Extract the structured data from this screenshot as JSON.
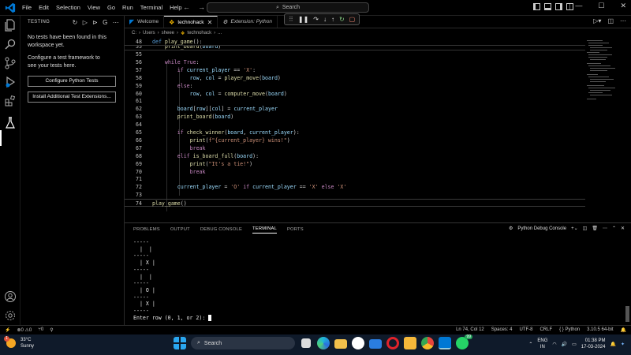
{
  "colors": {
    "keyword": "#c586c0",
    "def_keyword": "#569cd6",
    "function": "#dcdcaa",
    "string": "#ce9178",
    "variable": "#9cdcfe",
    "vscode_blue": "#0078d4",
    "python_tab_icon": "#f0b400"
  },
  "titlebar": {
    "menu": [
      "File",
      "Edit",
      "Selection",
      "View",
      "Go",
      "Run",
      "Terminal",
      "Help"
    ],
    "search_label": "Search",
    "icon": "vscode-logo-icon"
  },
  "sidebar": {
    "title": "TESTING",
    "empty_message": "No tests have been found in this workspace yet.",
    "configure_message": "Configure a test framework to see your tests here.",
    "configure_button": "Configure Python Tests",
    "install_button": "Install Additional Test Extensions..."
  },
  "tabs": [
    {
      "label": "Welcome",
      "active": false,
      "preview": false
    },
    {
      "label": "technohack",
      "active": true,
      "preview": false
    },
    {
      "label": "Extension: Python",
      "active": false,
      "preview": true
    }
  ],
  "breadcrumb": [
    "C:",
    "Users",
    "sheee",
    "technohack",
    "..."
  ],
  "editor": {
    "sticky": [
      {
        "n": "48",
        "text": "def play_game():"
      },
      {
        "n": "55",
        "text": "    print_board(board)"
      }
    ],
    "lines": [
      {
        "n": "55",
        "text": ""
      },
      {
        "n": "56",
        "text": "    while True:"
      },
      {
        "n": "57",
        "text": "        if current_player == 'X':"
      },
      {
        "n": "58",
        "text": "            row, col = player_move(board)"
      },
      {
        "n": "59",
        "text": "        else:"
      },
      {
        "n": "60",
        "text": "            row, col = computer_move(board)"
      },
      {
        "n": "61",
        "text": ""
      },
      {
        "n": "62",
        "text": "        board[row][col] = current_player"
      },
      {
        "n": "63",
        "text": "        print_board(board)"
      },
      {
        "n": "64",
        "text": ""
      },
      {
        "n": "65",
        "text": "        if check_winner(board, current_player):"
      },
      {
        "n": "66",
        "text": "            print(f\"{current_player} wins!\")"
      },
      {
        "n": "67",
        "text": "            break"
      },
      {
        "n": "68",
        "text": "        elif is_board_full(board):"
      },
      {
        "n": "69",
        "text": "            print(\"It's a tie!\")"
      },
      {
        "n": "70",
        "text": "            break"
      },
      {
        "n": "71",
        "text": ""
      },
      {
        "n": "72",
        "text": "        current_player = 'O' if current_player == 'X' else 'X'"
      },
      {
        "n": "73",
        "text": ""
      },
      {
        "n": "74",
        "text": "play_game()"
      }
    ],
    "current_line": "74"
  },
  "panel": {
    "tabs": [
      "PROBLEMS",
      "OUTPUT",
      "DEBUG CONSOLE",
      "TERMINAL",
      "PORTS"
    ],
    "active_tab": "TERMINAL",
    "terminal_name": "Python Debug Console",
    "terminal_lines": [
      "-----",
      "  |  |",
      "-----",
      "  | X |",
      "-----",
      "  |  |",
      "-----",
      "  | O |",
      "-----",
      "  | X |",
      "-----"
    ],
    "prompt": "Enter row (0, 1, or 2): "
  },
  "statusbar": {
    "errors": "0",
    "warnings": "0",
    "ports": "0",
    "position": "Ln 74, Col 12",
    "spaces": "Spaces: 4",
    "encoding": "UTF-8",
    "eol": "CRLF",
    "language": "Python",
    "interpreter": "3.10.5 64-bit"
  },
  "taskbar": {
    "temperature": "33°C",
    "weather": "Sunny",
    "weather_badge": "1",
    "search_label": "Search",
    "language_top": "ENG",
    "language_bottom": "IN",
    "time": "01:38 PM",
    "date": "17-03-2024",
    "whatsapp_badge": "99"
  }
}
